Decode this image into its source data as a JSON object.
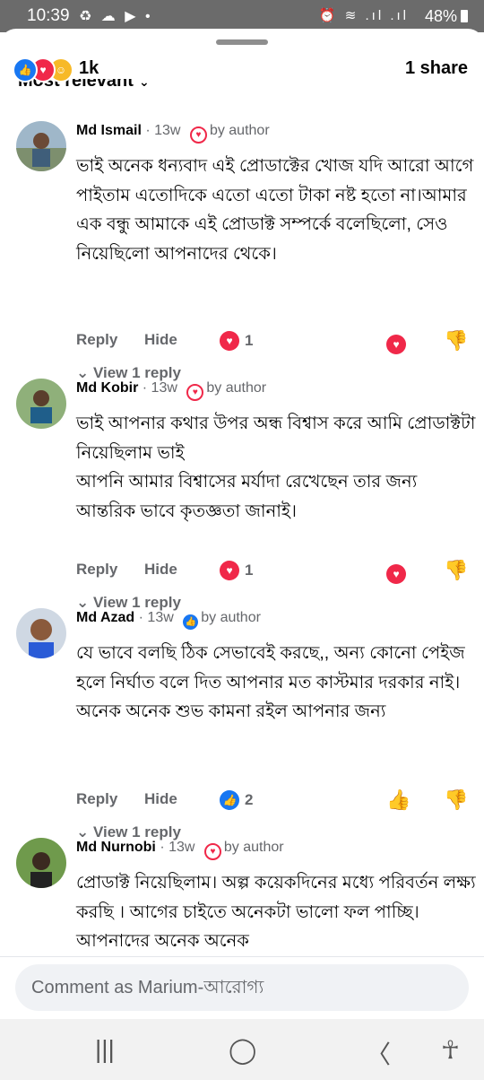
{
  "status_bar": {
    "time": "10:39",
    "left_icons": "♻ ☁ ▶ •",
    "right_icons": "⏰ ≋ .ıl .ıl",
    "battery": "48%"
  },
  "header": {
    "reaction_count": "1k",
    "share_count": "1 share",
    "sort_label": "Most relevant",
    "reaction_icons": [
      "like-icon",
      "love-icon",
      "care-icon"
    ]
  },
  "comments": [
    {
      "name": "Md Ismail",
      "time": "· 13w",
      "badge": "by author",
      "badge_type": "love",
      "text": "ভাই অনেক ধন্যবাদ এই প্রোডাক্টের খোজ যদি আরো আগে পাইতাম এতোদিকে এতো এতো টাকা নষ্ট হতো না।আমার এক বন্ধু আমাকে এই প্রোডাক্ট সম্পর্কে বলেছিলো, সেও নিয়েছিলো আপনাদের থেকে।",
      "reply_label": "Reply",
      "hide_label": "Hide",
      "reaction_count": "1",
      "view_reply": "View 1 reply"
    },
    {
      "name": "Md Kobir",
      "time": "· 13w",
      "badge": "by author",
      "badge_type": "love",
      "text": "ভাই আপনার কথার উপর অন্ধ বিশ্বাস করে আমি প্রোডাক্টটা নিয়েছিলাম ভাই\nআপনি আমার বিশ্বাসের মর্যাদা রেখেছেন তার জন্য আন্তরিক ভাবে কৃতজ্ঞতা জানাই।",
      "reply_label": "Reply",
      "hide_label": "Hide",
      "reaction_count": "1",
      "view_reply": "View 1 reply"
    },
    {
      "name": "Md Azad",
      "time": "· 13w",
      "badge": "by author",
      "badge_type": "like",
      "text": "যে ভাবে বলছি ঠিক সেভাবেই করছে,, অন্য কোনো পেইজ হলে নির্ঘাত বলে দিত আপনার মত কাস্টমার দরকার নাই।\nঅনেক অনেক শুভ কামনা রইল আপনার জন্য",
      "reply_label": "Reply",
      "hide_label": "Hide",
      "reaction_count": "2",
      "view_reply": "View 1 reply"
    },
    {
      "name": "Md Nurnobi",
      "time": "· 13w",
      "badge": "by author",
      "badge_type": "love",
      "text": "প্রোডাক্ট নিয়েছিলাম। অল্প কয়েকদিনের মধ্যে পরিবর্তন লক্ষ্য করছি । আগের চাইতে অনেকটা ভালো ফল পাচ্ছি। আপনাদের অনেক অনেক"
    }
  ],
  "composer": {
    "placeholder": "Comment as Marium-আরোগ্য"
  },
  "nav": {
    "recents": "|||",
    "home": "◯",
    "back": "〈",
    "accessibility": "🯅"
  }
}
